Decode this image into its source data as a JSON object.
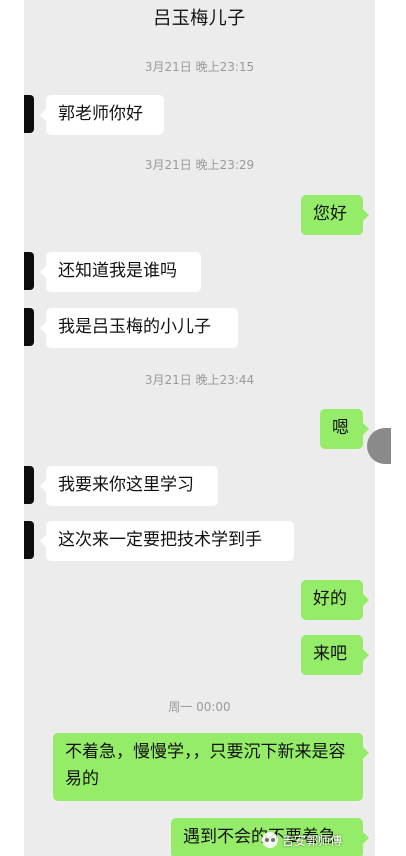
{
  "header": {
    "title": "吕玉梅儿子"
  },
  "timestamps": [
    "3月21日 晚上23:15",
    "3月21日 晚上23:29",
    "3月21日 晚上23:44",
    "周一 00:00"
  ],
  "messages": [
    {
      "side": "in",
      "text": "郭老师你好"
    },
    {
      "side": "out",
      "text": "您好"
    },
    {
      "side": "in",
      "text": "还知道我是谁吗"
    },
    {
      "side": "in",
      "text": "我是吕玉梅的小儿子"
    },
    {
      "side": "out",
      "text": "嗯"
    },
    {
      "side": "in",
      "text": "我要来你这里学习"
    },
    {
      "side": "in",
      "text": "这次来一定要把技术学到手"
    },
    {
      "side": "out",
      "text": "好的"
    },
    {
      "side": "out",
      "text": "来吧"
    },
    {
      "side": "out",
      "text": "不着急，慢慢学，，只要沉下新来是容易的"
    },
    {
      "side": "out",
      "text": "遇到不会的不要着急"
    }
  ],
  "watermark": {
    "text": "吉安郭师傅"
  },
  "colors": {
    "background": "#ececec",
    "incoming_bubble": "#ffffff",
    "outgoing_bubble": "#95ec69"
  }
}
